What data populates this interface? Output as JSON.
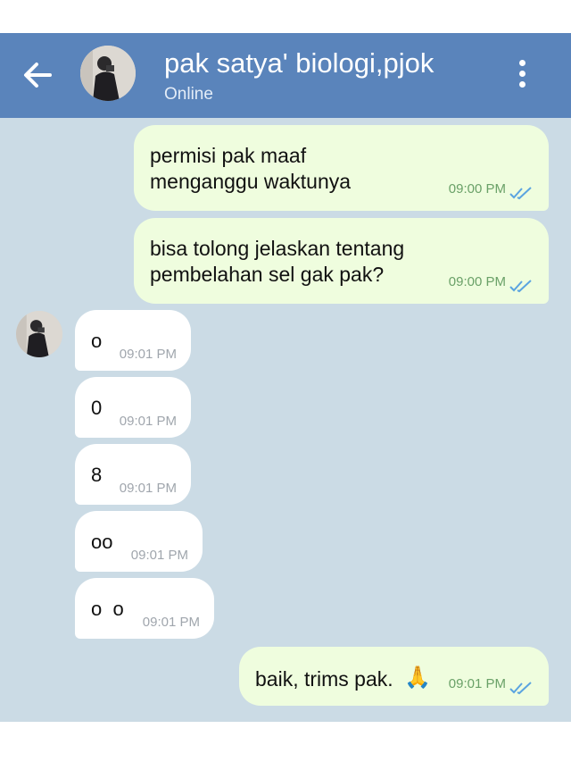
{
  "header": {
    "title": "pak satya' biologi,pjok",
    "status": "Online",
    "back_icon": "arrow-left-icon",
    "menu_icon": "more-vertical-icon"
  },
  "colors": {
    "header": "#5a84bb",
    "chat_background": "#cbdbe5",
    "outgoing_bubble": "#effdde",
    "incoming_bubble": "#ffffff",
    "outgoing_time": "#6aa168",
    "read_ticks": "#5ba4e0"
  },
  "messages": [
    {
      "direction": "out",
      "text_lines": [
        "permisi pak maaf",
        "menganggu waktunya"
      ],
      "time": "09:00 PM",
      "read": true
    },
    {
      "direction": "out",
      "text_lines": [
        "bisa tolong jelaskan tentang",
        "pembelahan sel gak pak?"
      ],
      "time": "09:00 PM",
      "read": true
    },
    {
      "direction": "in",
      "text": "o",
      "time": "09:01 PM"
    },
    {
      "direction": "in",
      "text": "0",
      "time": "09:01 PM"
    },
    {
      "direction": "in",
      "text": "8",
      "time": "09:01 PM"
    },
    {
      "direction": "in",
      "text": "oo",
      "time": "09:01 PM"
    },
    {
      "direction": "in",
      "text": "o  o",
      "time": "09:01 PM"
    },
    {
      "direction": "out",
      "text": "baik, trims pak.",
      "emoji": "🙏",
      "time": "09:01 PM",
      "read": true
    }
  ]
}
